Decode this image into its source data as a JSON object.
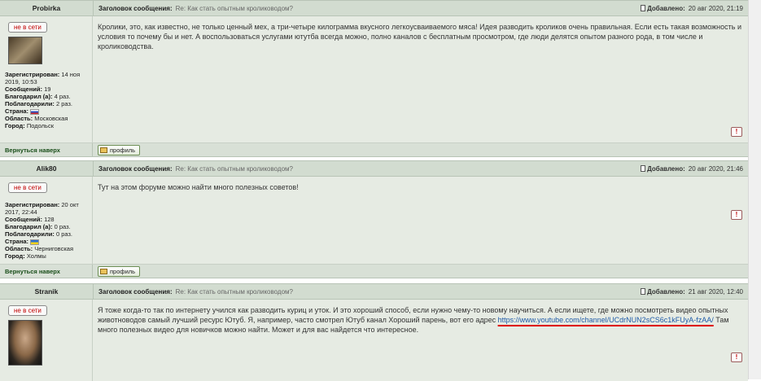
{
  "common": {
    "subject_label": "Заголовок сообщения:",
    "date_label": "Добавлено:",
    "back_to_top": "Вернуться наверх",
    "profile_button": "профиль",
    "report_symbol": "!"
  },
  "posts": [
    {
      "username": "Probirka",
      "status": "не в сети",
      "subject": "Re: Как стать опытным кролиководом?",
      "date": "20 авг 2020, 21:19",
      "reg_label": "Зарегистрирован:",
      "reg_value": "14 ноя 2019, 10:53",
      "msgs_label": "Сообщений:",
      "msgs_value": "19",
      "thanked_label": "Благодарил (а):",
      "thanked_value": "4 раз.",
      "got_thanks_label": "Поблагодарили:",
      "got_thanks_value": "2 раз.",
      "country_label": "Страна:",
      "country_flag": "ru",
      "region_label": "Область:",
      "region_value": "Московская",
      "city_label": "Город:",
      "city_value": "Подольск",
      "text": "Кролики, это, как известно, не только ценный мех, а три-четыре килограмма вкусного легкоусваиваемого мяса! Идея разводить кроликов очень правильная. Если есть такая возможность и условия то почему бы и нет. А воспользоваться услугами ютутба всегда можно, полно каналов с бесплатным просмотром, где люди делятся опытом разного рода, в том числе и кролиководства."
    },
    {
      "username": "Alik80",
      "status": "не в сети",
      "subject": "Re: Как стать опытным кролиководом?",
      "date": "20 авг 2020, 21:46",
      "reg_label": "Зарегистрирован:",
      "reg_value": "20 окт 2017, 22:44",
      "msgs_label": "Сообщений:",
      "msgs_value": "128",
      "thanked_label": "Благодарил (а):",
      "thanked_value": "0 раз.",
      "got_thanks_label": "Поблагодарили:",
      "got_thanks_value": "0 раз.",
      "country_label": "Страна:",
      "country_flag": "ua",
      "region_label": "Область:",
      "region_value": "Черниговская",
      "city_label": "Город:",
      "city_value": "Холмы",
      "text": "Тут на этом форуме можно найти много полезных советов!"
    },
    {
      "username": "Stranik",
      "status": "не в сети",
      "subject": "Re: Как стать опытным кролиководом?",
      "date": "21 авг 2020, 12:40",
      "text_before": "Я тоже когда-то так по интернету учился как разводить куриц и уток. И это хороший способ, если нужно чему-то новому научиться. А если ищете, где можно посмотреть видео опытных животноводов самый лучший ресурс Ютуб. Я, например, часто смотрел Ютуб канал Хороший парень, вот его адрес",
      "link": "https://www.youtube.com/channel/UCdrNUN2sCS6c1kFUyA-fzAA/",
      "text_after": "Там много полезных видео для новичков можно найти. Может и для вас найдется что интересное."
    }
  ]
}
